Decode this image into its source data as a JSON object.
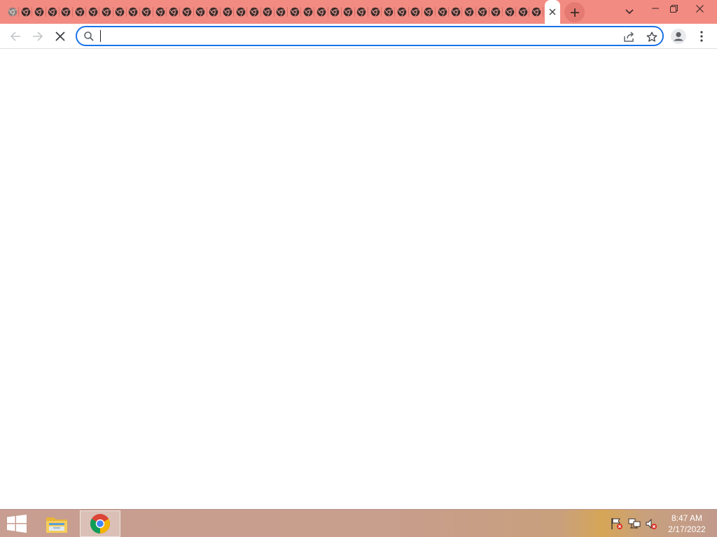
{
  "browser": {
    "tab_count": 40,
    "active_tab": {
      "close_icon": "close-icon"
    },
    "new_tab_icon": "plus-icon",
    "tab_search_icon": "chevron-down-icon",
    "window_controls": [
      "minimize-icon",
      "restore-icon",
      "close-icon"
    ]
  },
  "toolbar": {
    "back_icon": "arrow-left-icon",
    "forward_icon": "arrow-right-icon",
    "stop_icon": "close-icon",
    "omnibox": {
      "value": "",
      "placeholder": ""
    },
    "share_icon": "share-icon",
    "bookmark_icon": "star-icon",
    "profile_icon": "person-icon",
    "menu_icon": "kebab-icon"
  },
  "taskbar": {
    "apps": [
      "file-explorer-icon",
      "chrome-icon"
    ],
    "tray": [
      "flag-icon",
      "network-icon",
      "speaker-muted-icon"
    ],
    "clock": {
      "time": "8:47 AM",
      "date": "2/17/2022"
    }
  },
  "colors": {
    "tabstrip": "#f28b82",
    "accent": "#1a73e8"
  }
}
